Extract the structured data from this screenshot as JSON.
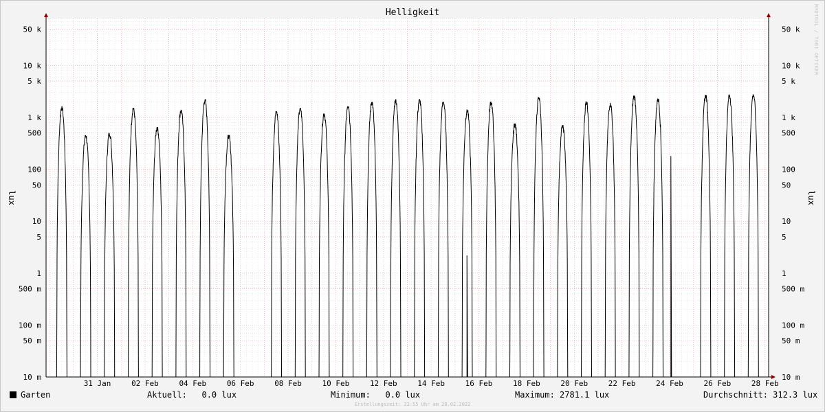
{
  "chart_data": {
    "type": "line",
    "title": "Helligkeit",
    "ylabel": "lux",
    "y_scale": "log",
    "ylim": [
      10,
      80000
    ],
    "yticks": [
      {
        "value": 10,
        "label": "10 m"
      },
      {
        "value": 50,
        "label": "50 m"
      },
      {
        "value": 100,
        "label": "100 m"
      },
      {
        "value": 500,
        "label": "500 m"
      },
      {
        "value": 1000,
        "label": "1"
      },
      {
        "value": 5000,
        "label": "5"
      },
      {
        "value": 10000,
        "label": "10"
      },
      {
        "value": 50000,
        "label": "50"
      },
      {
        "value": 100000,
        "label": "100"
      },
      {
        "value": 500000,
        "label": "500"
      },
      {
        "value": 1000000,
        "label": "1 k"
      },
      {
        "value": 5000000,
        "label": "5 k"
      },
      {
        "value": 10000000,
        "label": "10 k"
      },
      {
        "value": 50000000,
        "label": "50 k"
      }
    ],
    "x_labels": [
      "31 Jan",
      "02 Feb",
      "04 Feb",
      "06 Feb",
      "08 Feb",
      "10 Feb",
      "12 Feb",
      "14 Feb",
      "16 Feb",
      "18 Feb",
      "20 Feb",
      "22 Feb",
      "24 Feb",
      "26 Feb",
      "28 Feb"
    ],
    "x_range": [
      "29 Jan",
      "28 Feb"
    ],
    "grid": true,
    "series": [
      {
        "name": "Garten",
        "color": "#000000",
        "unit": "mlux",
        "daily_peaks": [
          {
            "date": "29 Jan",
            "peak": 1600000
          },
          {
            "date": "30 Jan",
            "peak": 450000
          },
          {
            "date": "31 Jan",
            "peak": 500000
          },
          {
            "date": "01 Feb",
            "peak": 1500000
          },
          {
            "date": "02 Feb",
            "peak": 650000
          },
          {
            "date": "03 Feb",
            "peak": 1400000
          },
          {
            "date": "04 Feb",
            "peak": 2200000
          },
          {
            "date": "05 Feb",
            "peak": 450000
          },
          {
            "date": "06 Feb",
            "peak": null
          },
          {
            "date": "07 Feb",
            "peak": 1300000
          },
          {
            "date": "08 Feb",
            "peak": 1500000
          },
          {
            "date": "09 Feb",
            "peak": 1200000
          },
          {
            "date": "10 Feb",
            "peak": 1600000
          },
          {
            "date": "11 Feb",
            "peak": 2000000
          },
          {
            "date": "12 Feb",
            "peak": 2200000
          },
          {
            "date": "13 Feb",
            "peak": 2200000
          },
          {
            "date": "14 Feb",
            "peak": 2000000
          },
          {
            "date": "15 Feb",
            "peak": 1400000
          },
          {
            "date": "16 Feb",
            "peak": 2000000
          },
          {
            "date": "17 Feb",
            "peak": 750000
          },
          {
            "date": "18 Feb",
            "peak": 2400000
          },
          {
            "date": "19 Feb",
            "peak": 700000
          },
          {
            "date": "20 Feb",
            "peak": 2000000
          },
          {
            "date": "21 Feb",
            "peak": 1900000
          },
          {
            "date": "22 Feb",
            "peak": 2600000
          },
          {
            "date": "23 Feb",
            "peak": 2300000
          },
          {
            "date": "24 Feb",
            "peak": null
          },
          {
            "date": "25 Feb",
            "peak": 2700000
          },
          {
            "date": "26 Feb",
            "peak": 2700000
          },
          {
            "date": "27 Feb",
            "peak": 2780000
          }
        ]
      }
    ],
    "legend": {
      "series_name": "Garten",
      "aktuell": "Aktuell:   0.0 lux",
      "minimum": "Minimum:   0.0 lux",
      "maximum": "Maximum: 2781.1 lux",
      "durchschnitt": "Durchschnitt: 312.3 lux"
    },
    "footer": "Erstellungszeit: 23:55 Uhr am 28.02.2022",
    "watermark": "RRDTOOL / TOBI OETIKER"
  }
}
